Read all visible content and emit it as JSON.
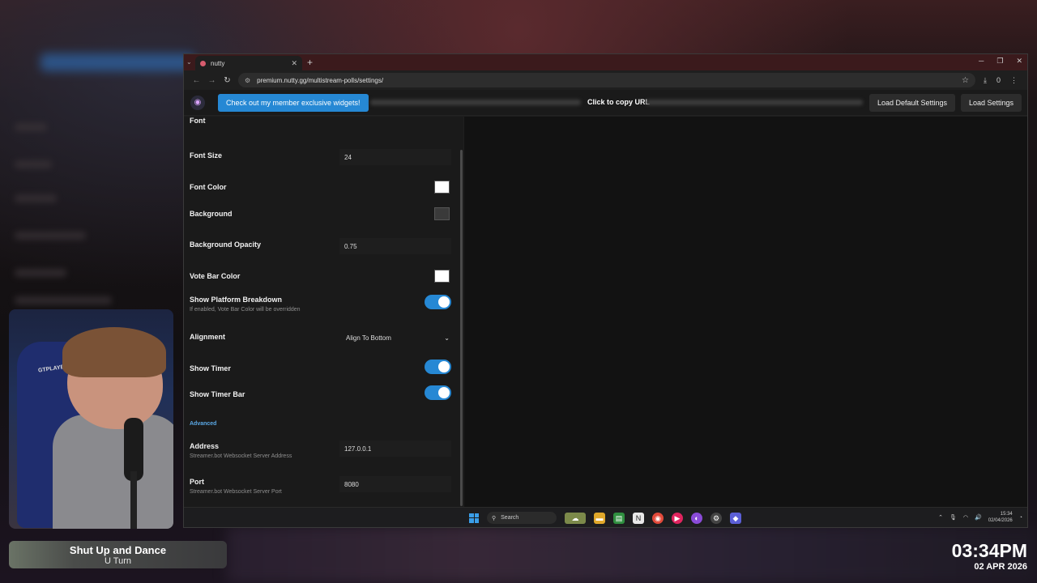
{
  "browser": {
    "tab_title": "nutty",
    "url": "premium.nutty.gg/multistream-polls/settings/",
    "download_count": "0"
  },
  "header": {
    "member_button": "Check out my member exclusive widgets!",
    "copy_url": "Click to copy URL",
    "load_default": "Load Default Settings",
    "load_settings": "Load Settings"
  },
  "settings": {
    "font_label": "Font",
    "font_size_label": "Font Size",
    "font_size_value": "24",
    "font_color_label": "Font Color",
    "font_color": "#ffffff",
    "background_label": "Background",
    "background_color": "#3a3a3a",
    "background_opacity_label": "Background Opacity",
    "background_opacity_value": "0.75",
    "vote_bar_color_label": "Vote Bar Color",
    "vote_bar_color": "#ffffff",
    "platform_breakdown_label": "Show Platform Breakdown",
    "platform_breakdown_sub": "If enabled, Vote Bar Color will be overridden",
    "alignment_label": "Alignment",
    "alignment_value": "Align To Bottom",
    "show_timer_label": "Show Timer",
    "show_timer_bar_label": "Show Timer Bar",
    "advanced_label": "Advanced",
    "address_label": "Address",
    "address_sub": "Streamer.bot Websocket Server Address",
    "address_value": "127.0.0.1",
    "port_label": "Port",
    "port_sub": "Streamer.bot Websocket Server Port",
    "port_value": "8080"
  },
  "taskbar": {
    "search_label": "Search",
    "time": "15:34",
    "date": "02/04/2026"
  },
  "overlay": {
    "song_title": "Shut Up and Dance",
    "song_artist": "U Turn",
    "clock_time": "03:34PM",
    "clock_date": "02 APR 2026",
    "webcam_chair_text": "GTPLAYER"
  },
  "colors": {
    "accent": "#2688d4",
    "advanced_link": "#5aa8e6"
  }
}
